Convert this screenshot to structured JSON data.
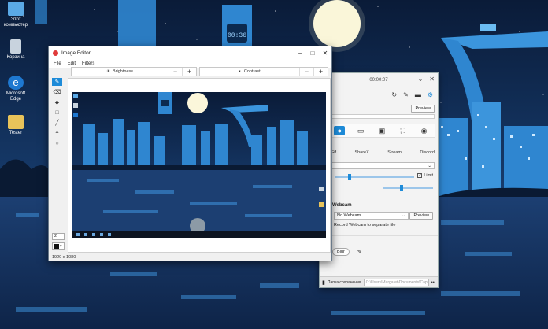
{
  "desktop": {
    "icons": [
      {
        "label": "Этот компьютер",
        "icon": "computer-icon"
      },
      {
        "label": "Корзина",
        "icon": "recycle-bin-icon"
      },
      {
        "label": "Microsoft Edge",
        "icon": "edge-icon"
      },
      {
        "label": "Tester",
        "icon": "folder-icon"
      }
    ],
    "clock_display": "00:36"
  },
  "capture_window": {
    "title": "00:00:07",
    "preview_label": "Preview",
    "tabs": [
      "Gif",
      "ShareX",
      "Stream",
      "Discord"
    ],
    "limit_label": "Limit",
    "webcam_section": "Webcam",
    "webcam_value": "No Webcam",
    "webcam_preview_label": "Preview",
    "separate_file_label": "Record Webcam to separate file",
    "blur_label": "Blur",
    "folder_label": "Папка сохранения",
    "folder_path": "C:\\Users\\Margaret\\Documents\\Captura",
    "more_label": "•••"
  },
  "editor": {
    "title": "Image Editor",
    "menu": [
      "File",
      "Edit",
      "Filters"
    ],
    "brightness_label": "Brightness",
    "contrast_label": "Contrast",
    "minus": "−",
    "plus": "+",
    "brush_size": "2",
    "image_size": "1920 x 1080"
  },
  "colors": {
    "accent": "#1e8bd8",
    "sky_top": "#0b1d3a",
    "sky_bottom": "#1f4d86",
    "city_blue": "#2f86d0"
  }
}
